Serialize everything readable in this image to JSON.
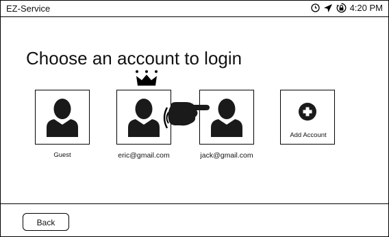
{
  "app": {
    "title": "EZ-Service"
  },
  "status_bar": {
    "time": "4:20 PM",
    "icons": [
      "clock-icon",
      "location-arrow-icon",
      "lock-rotation-icon"
    ]
  },
  "page": {
    "heading": "Choose an account to login"
  },
  "accounts": [
    {
      "label": "Guest",
      "icon": "user-avatar-icon"
    },
    {
      "label": "eric@gmail.com",
      "icon": "user-avatar-icon",
      "badge": "crown-icon"
    },
    {
      "label": "jack@gmail.com",
      "icon": "user-avatar-icon"
    }
  ],
  "add_account": {
    "label": "Add Account",
    "icon": "plus-circle-icon"
  },
  "footer": {
    "back_label": "Back"
  },
  "colors": {
    "border": "#000000",
    "icon_fill": "#1a1a1a",
    "background": "#ffffff"
  }
}
